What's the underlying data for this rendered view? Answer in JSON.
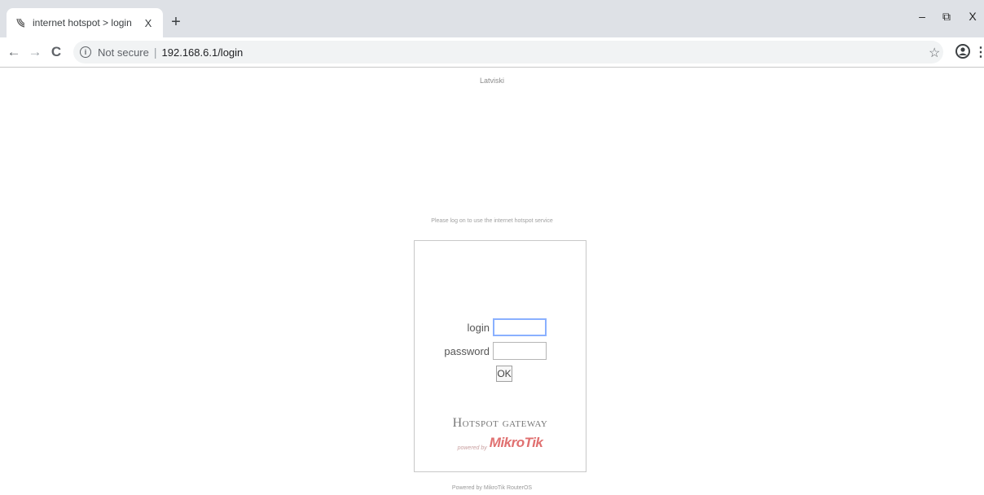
{
  "browser": {
    "tab_title": "internet hotspot > login",
    "tab_close": "X",
    "new_tab": "+",
    "window_minimize": "–",
    "window_restore": "⧉",
    "window_close": "X",
    "nav_back": "←",
    "nav_forward": "→",
    "nav_reload": "C",
    "security_label": "Not secure",
    "address_separator": "|",
    "url": "192.168.6.1/login"
  },
  "page": {
    "language_link": "Latviski",
    "notice": "Please log on to use the internet hotspot service",
    "login_label": "login",
    "password_label": "password",
    "login_value": "",
    "password_value": "",
    "ok_button": "OK",
    "brand_title": "Hotspot gateway",
    "powered_by_small": "powered by",
    "brand_logo": "MikroTik",
    "footer": "Powered by MikroTik RouterOS"
  },
  "colors": {
    "tabstrip_bg": "#dee1e6",
    "omnibox_bg": "#f1f3f4",
    "focus_border": "#8ab0ff",
    "brand_red": "#e07070"
  }
}
